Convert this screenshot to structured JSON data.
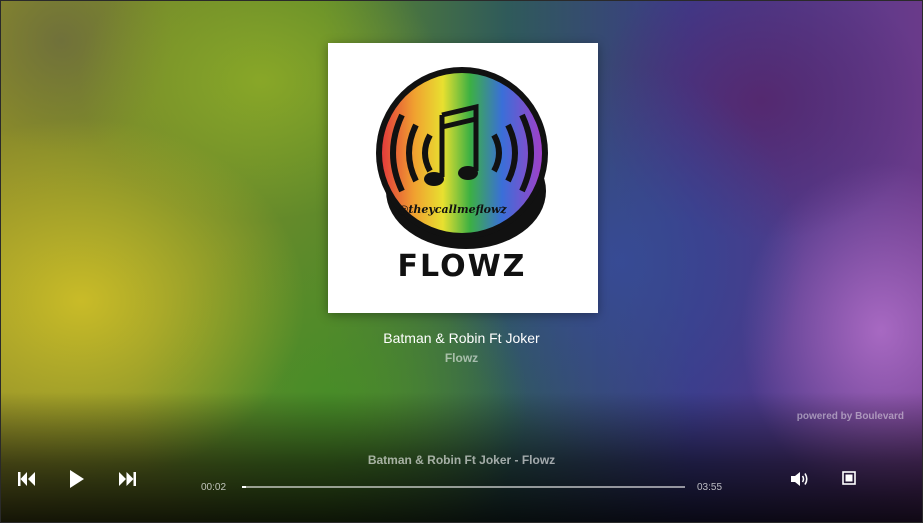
{
  "track": {
    "title": "Batman & Robin Ft Joker",
    "artist": "Flowz",
    "now_playing": "Batman & Robin Ft Joker - Flowz"
  },
  "cover_art": {
    "handle_text": "@theycallmeflowz",
    "logo_text": "FLOWZ"
  },
  "branding": {
    "powered_by": "powered by Boulevard"
  },
  "playback": {
    "current_time": "00:02",
    "duration": "03:55",
    "progress_fraction": 0.009
  },
  "controls": {
    "previous_icon": "skip-back-icon",
    "play_icon": "play-icon",
    "next_icon": "skip-forward-icon",
    "volume_icon": "volume-icon",
    "fullscreen_icon": "fullscreen-icon"
  }
}
